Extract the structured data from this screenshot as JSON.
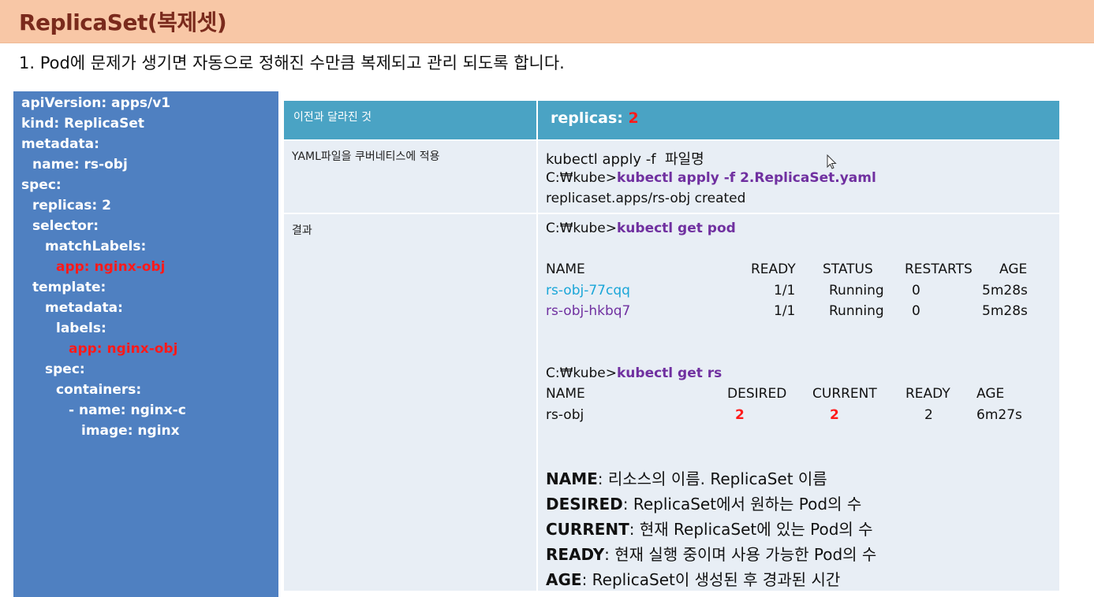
{
  "title": "ReplicaSet(복제셋)",
  "intro": "1.  Pod에 문제가 생기면 자동으로 정해진 수만큼 복제되고 관리 되도록 합니다.",
  "yaml": [
    {
      "text": "apiVersion: apps/v1",
      "indent": 0,
      "highlight": false
    },
    {
      "text": "kind: ReplicaSet",
      "indent": 0,
      "highlight": false
    },
    {
      "text": "metadata:",
      "indent": 0,
      "highlight": false
    },
    {
      "text": "name: rs-obj",
      "indent": 1,
      "highlight": false
    },
    {
      "text": "spec:",
      "indent": 0,
      "highlight": false
    },
    {
      "text": "replicas: 2",
      "indent": 1,
      "highlight": false
    },
    {
      "text": "selector:",
      "indent": 1,
      "highlight": false
    },
    {
      "text": "matchLabels:",
      "indent": 2,
      "highlight": false
    },
    {
      "text": "app: nginx-obj",
      "indent": 3,
      "highlight": true
    },
    {
      "text": "template:",
      "indent": 1,
      "highlight": false
    },
    {
      "text": "metadata:",
      "indent": 2,
      "highlight": false
    },
    {
      "text": "labels:",
      "indent": 3,
      "highlight": false
    },
    {
      "text": "app: nginx-obj",
      "indent": 4,
      "highlight": true
    },
    {
      "text": "spec:",
      "indent": 2,
      "highlight": false
    },
    {
      "text": "containers:",
      "indent": 3,
      "highlight": false
    },
    {
      "text": "- name: nginx-c",
      "indent": 4,
      "highlight": false
    },
    {
      "text": "image: nginx",
      "indent": 5,
      "highlight": false
    }
  ],
  "table": {
    "header_label": "이전과 달라진 것",
    "header_value_prefix": "replicas: ",
    "header_value_num": "2",
    "row1_label": "YAML파일을 쿠버네티스에 적용",
    "row1_line1": "kubectl apply -f  파일명",
    "row1_prompt": "C:₩kube>",
    "row1_cmd": "kubectl apply -f 2.ReplicaSet.yaml",
    "row1_output": "replicaset.apps/rs-obj created",
    "row2_label": "결과",
    "pod_prompt": "C:₩kube>",
    "pod_cmd": "kubectl get pod",
    "pod_headers": [
      "NAME",
      "READY",
      "STATUS",
      "RESTARTS",
      "AGE"
    ],
    "pods": [
      {
        "name": "rs-obj-77cqq",
        "ready": "1/1",
        "status": "Running",
        "restarts": "0",
        "age": "5m28s"
      },
      {
        "name": "rs-obj-hkbq7",
        "ready": "1/1",
        "status": "Running",
        "restarts": "0",
        "age": "5m28s"
      }
    ],
    "rs_prompt": "C:₩kube>",
    "rs_cmd": "kubectl get rs",
    "rs_headers": [
      "NAME",
      "DESIRED",
      "CURRENT",
      "READY",
      "AGE"
    ],
    "rs_row": {
      "name": "rs-obj",
      "desired": "2",
      "current": "2",
      "ready": "2",
      "age": "6m27s"
    },
    "definitions": [
      {
        "term": "NAME",
        "desc": ": 리소스의 이름. ReplicaSet 이름"
      },
      {
        "term": "DESIRED",
        "desc": ": ReplicaSet에서 원하는 Pod의 수"
      },
      {
        "term": "CURRENT",
        "desc": ": 현재 ReplicaSet에 있는 Pod의 수"
      },
      {
        "term": "READY",
        "desc": ": 현재 실행 중이며 사용 가능한 Pod의 수"
      },
      {
        "term": "AGE",
        "desc": ": ReplicaSet이 생성된 후 경과된 시간"
      }
    ]
  },
  "colors": {
    "title_bg": "#f8c7a6",
    "yaml_bg": "#4f80c1",
    "header_bg": "#4aa3c4",
    "cell_bg": "#e8eef5",
    "highlight": "#ff1a1a",
    "command": "#7030a0"
  }
}
